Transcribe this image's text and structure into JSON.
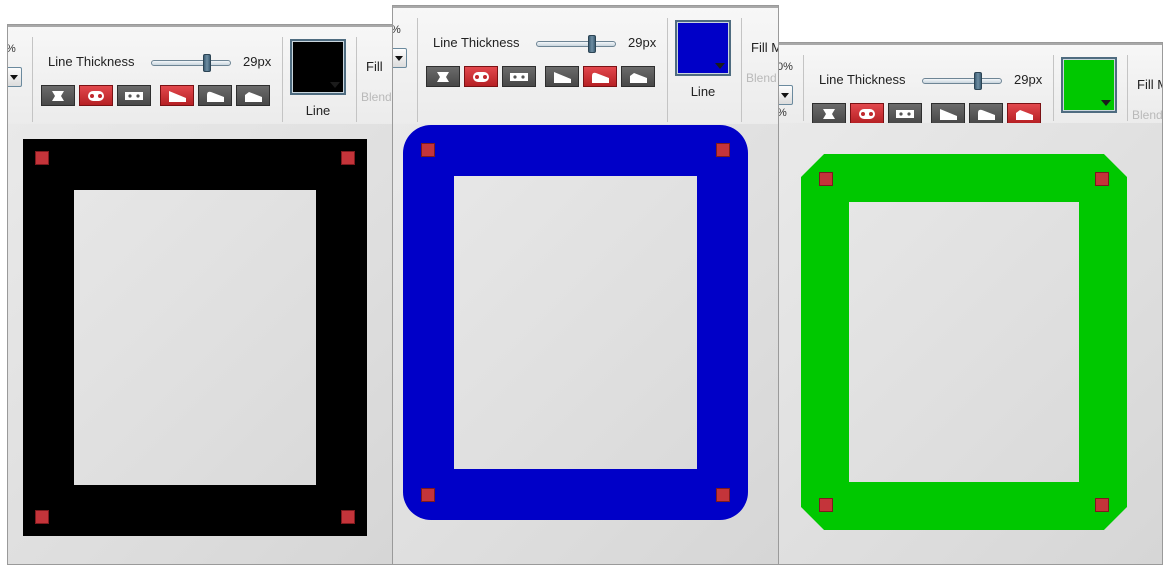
{
  "panels": [
    {
      "id": "mitered",
      "zoom_fragment": "%",
      "line_thickness_label": "Line Thickness",
      "line_thickness_value": "29px",
      "thickness_level": 0.72,
      "cap_buttons": [
        {
          "name": "butt-cap-button",
          "icon": "butt-cap-icon",
          "active": false
        },
        {
          "name": "round-cap-button",
          "icon": "round-cap-icon",
          "active": true
        },
        {
          "name": "square-cap-button",
          "icon": "square-cap-icon",
          "active": false
        }
      ],
      "join_buttons": [
        {
          "name": "miter-join-button",
          "icon": "miter-join-icon",
          "active": true
        },
        {
          "name": "round-join-button",
          "icon": "round-join-icon",
          "active": false
        },
        {
          "name": "bevel-join-button",
          "icon": "bevel-join-icon",
          "active": false
        }
      ],
      "line_color": "#000000",
      "line_label": "Line",
      "fill_label": "Fill",
      "blend_label": "Blend",
      "join_style": "miter"
    },
    {
      "id": "rounded",
      "zoom_fragment": "%",
      "line_thickness_label": "Line Thickness",
      "line_thickness_value": "29px",
      "thickness_level": 0.72,
      "cap_buttons": [
        {
          "name": "butt-cap-button",
          "icon": "butt-cap-icon",
          "active": false
        },
        {
          "name": "round-cap-button",
          "icon": "round-cap-icon",
          "active": true
        },
        {
          "name": "square-cap-button",
          "icon": "square-cap-icon",
          "active": false
        }
      ],
      "join_buttons": [
        {
          "name": "miter-join-button",
          "icon": "miter-join-icon",
          "active": false
        },
        {
          "name": "round-join-button",
          "icon": "round-join-icon",
          "active": true
        },
        {
          "name": "bevel-join-button",
          "icon": "bevel-join-icon",
          "active": false
        }
      ],
      "line_color": "#0000c8",
      "line_label": "Line",
      "fill_label": "Fill M",
      "blend_label": "Blend",
      "join_style": "round"
    },
    {
      "id": "beveled",
      "zoom_fragment": "0%",
      "zoom_fragment_lower": "%",
      "line_thickness_label": "Line Thickness",
      "line_thickness_value": "29px",
      "thickness_level": 0.72,
      "cap_buttons": [
        {
          "name": "butt-cap-button",
          "icon": "butt-cap-icon",
          "active": false
        },
        {
          "name": "round-cap-button",
          "icon": "round-cap-icon",
          "active": true
        },
        {
          "name": "square-cap-button",
          "icon": "square-cap-icon",
          "active": false
        }
      ],
      "join_buttons": [
        {
          "name": "miter-join-button",
          "icon": "miter-join-icon",
          "active": false
        },
        {
          "name": "round-join-button",
          "icon": "round-join-icon",
          "active": false
        },
        {
          "name": "bevel-join-button",
          "icon": "bevel-join-icon",
          "active": true
        }
      ],
      "line_color": "#00c800",
      "line_label": "Line",
      "fill_label": "Fill M",
      "blend_label": "Blend",
      "join_style": "bevel"
    }
  ]
}
